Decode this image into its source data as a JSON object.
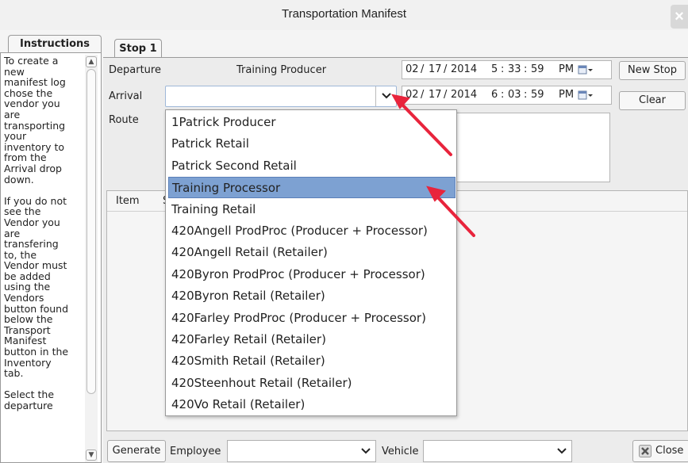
{
  "window": {
    "title": "Transportation Manifest",
    "close_glyph": "×"
  },
  "tabs": {
    "instructions": "Instructions",
    "stop": "Stop 1"
  },
  "instructions": {
    "text": "To create a\nnew\nmanifest log\nchose the\nvendor you\nare\ntransporting\nyour\ninventory to\nfrom the\nArrival drop\ndown.\n\nIf you do not\nsee the\nVendor you\nare\ntransfering\nto, the\nVendor must\nbe added\nusing the\nVendors\nbutton found\nbelow the\nTransport\nManifest\nbutton in the\nInventory\ntab.\n\nSelect the\ndeparture"
  },
  "form": {
    "departure_label": "Departure",
    "departure_value": "Training Producer",
    "arrival_label": "Arrival",
    "arrival_value": "",
    "route_label": "Route",
    "departure_dt": {
      "month": "02",
      "day": "17",
      "year": "2014",
      "hour": "5",
      "minute": "33",
      "second": "59",
      "ampm": "PM"
    },
    "arrival_dt": {
      "month": "02",
      "day": "17",
      "year": "2014",
      "hour": "6",
      "minute": "03",
      "second": "59",
      "ampm": "PM"
    },
    "sep_date": "/",
    "sep_time": ":",
    "new_stop_label": "New Stop",
    "clear_label": "Clear"
  },
  "items_table": {
    "columns": [
      "Item",
      "S"
    ]
  },
  "dropdown": {
    "selected_index": 3,
    "options": [
      "1Patrick Producer",
      "Patrick Retail",
      "Patrick Second Retail",
      "Training Processor",
      "Training Retail",
      "420Angell ProdProc (Producer + Processor)",
      "420Angell Retail (Retailer)",
      "420Byron ProdProc (Producer + Processor)",
      "420Byron Retail (Retailer)",
      "420Farley ProdProc (Producer + Processor)",
      "420Farley Retail (Retailer)",
      "420Smith Retail (Retailer)",
      "420Steenhout Retail (Retailer)",
      "420Vo Retail (Retailer)"
    ]
  },
  "bottom": {
    "generate_label": "Generate",
    "employee_label": "Employee",
    "vehicle_label": "Vehicle",
    "close_label": "Close"
  },
  "icons": {
    "chevron_down": "chevron-down-icon",
    "calendar": "calendar-icon",
    "close_x": "close-x-icon",
    "annotation_arrow": "red-arrow-icon"
  },
  "colors": {
    "selection": "#7da1d2",
    "annotation": "#e8243c"
  }
}
